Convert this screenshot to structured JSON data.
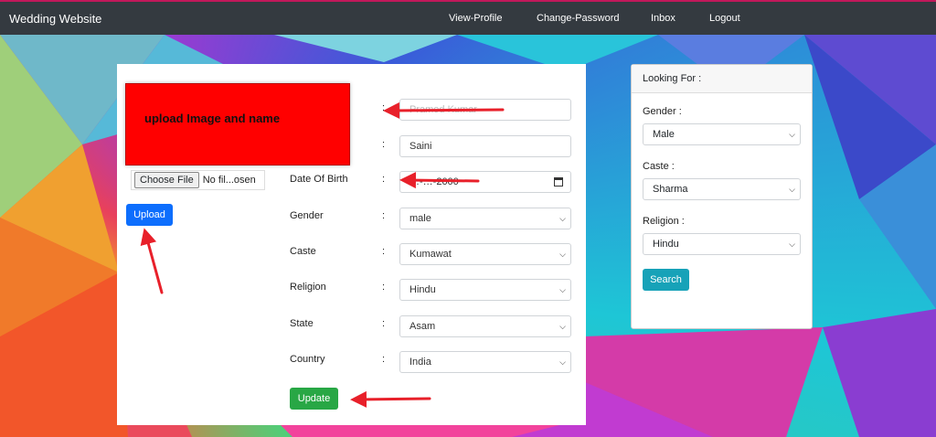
{
  "brand": "Wedding Website",
  "nav": [
    {
      "label": "View-Profile"
    },
    {
      "label": "Change-Password"
    },
    {
      "label": "Inbox"
    },
    {
      "label": "Logout"
    }
  ],
  "annotation": {
    "text": "upload Image and name"
  },
  "file_input": {
    "button_label": "Choose File",
    "status": "No fil...osen"
  },
  "upload_label": "Upload",
  "form": {
    "fields": [
      {
        "label": "",
        "value": "Pramod Kumar"
      },
      {
        "label": "",
        "value": "Saini"
      },
      {
        "label": "Date Of Birth",
        "value": "…-…-2000"
      },
      {
        "label": "Gender",
        "value": "male"
      },
      {
        "label": "Caste",
        "value": "Kumawat"
      },
      {
        "label": "Religion",
        "value": "Hindu"
      },
      {
        "label": "State",
        "value": "Asam"
      },
      {
        "label": "Country",
        "value": "India"
      }
    ],
    "update_label": "Update"
  },
  "search_panel": {
    "title": "Looking For :",
    "gender_label": "Gender :",
    "gender_value": "Male",
    "caste_label": "Caste :",
    "caste_value": "Sharma",
    "religion_label": "Religion :",
    "religion_value": "Hindu",
    "search_label": "Search"
  },
  "colors": {
    "nav_bg": "#343a40",
    "upload_btn": "#0d6efd",
    "update_btn": "#28a745",
    "search_btn": "#17a2b8",
    "annotation": "#ff0000",
    "arrow": "#e8202a"
  }
}
